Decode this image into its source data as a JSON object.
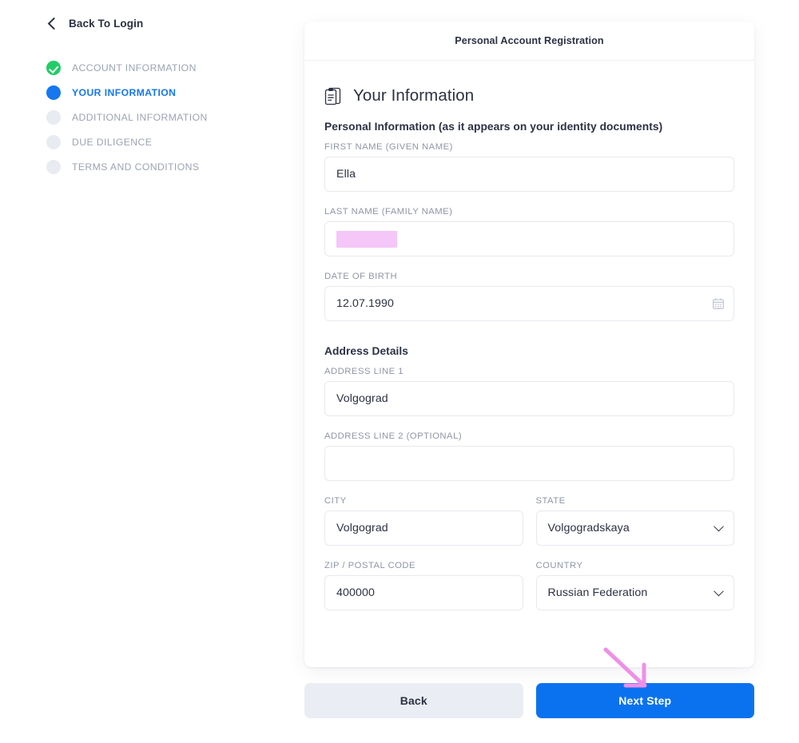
{
  "sidebar": {
    "back_link": {
      "label": "Back To Login",
      "icon": "chevron-left-icon"
    },
    "steps": [
      {
        "label": "ACCOUNT INFORMATION",
        "state": "done"
      },
      {
        "label": "YOUR INFORMATION",
        "state": "active"
      },
      {
        "label": "ADDITIONAL INFORMATION",
        "state": "pending"
      },
      {
        "label": "DUE DILIGENCE",
        "state": "pending"
      },
      {
        "label": "TERMS AND CONDITIONS",
        "state": "pending"
      }
    ]
  },
  "card": {
    "header_title": "Personal Account Registration",
    "section": {
      "icon": "document-clipboard-icon",
      "heading": "Your Information"
    },
    "groups": {
      "personal_title": "Personal Information (as it appears on your identity documents)",
      "address_title": "Address Details"
    },
    "fields": {
      "first_name": {
        "label": "FIRST NAME (GIVEN NAME)",
        "value": "Ella",
        "placeholder": ""
      },
      "last_name": {
        "label": "LAST NAME (FAMILY NAME)",
        "value": "",
        "placeholder": "",
        "redacted": true
      },
      "date_of_birth": {
        "label": "DATE OF BIRTH",
        "value": "12.07.1990",
        "placeholder": "",
        "icon": "calendar-icon"
      },
      "address_line_1": {
        "label": "ADDRESS LINE 1",
        "value": "Volgograd",
        "placeholder": ""
      },
      "address_line_2": {
        "label": "ADDRESS LINE 2 (OPTIONAL)",
        "value": "",
        "placeholder": ""
      },
      "city": {
        "label": "CITY",
        "value": "Volgograd",
        "placeholder": ""
      },
      "state": {
        "label": "STATE",
        "value": "Volgogradskaya",
        "placeholder": "",
        "icon": "chevron-down-icon"
      },
      "zip": {
        "label": "ZIP / POSTAL CODE",
        "value": "400000",
        "placeholder": ""
      },
      "country": {
        "label": "COUNTRY",
        "value": "Russian Federation",
        "placeholder": "",
        "icon": "chevron-down-icon"
      }
    }
  },
  "footer": {
    "back_label": "Back",
    "next_label": "Next Step"
  },
  "annotation": {
    "arrow": "down-right-arrow",
    "color": "#ef8fe8"
  },
  "colors": {
    "accent_blue": "#0b72ef",
    "active_blue": "#1677f0",
    "done_green": "#21cd66",
    "pending_gray": "#e9ebf2",
    "text_dark": "#2c3144",
    "label_gray": "#8f96a8",
    "redaction_pink": "#f5c6f8",
    "back_button_bg": "#eaedf3"
  }
}
